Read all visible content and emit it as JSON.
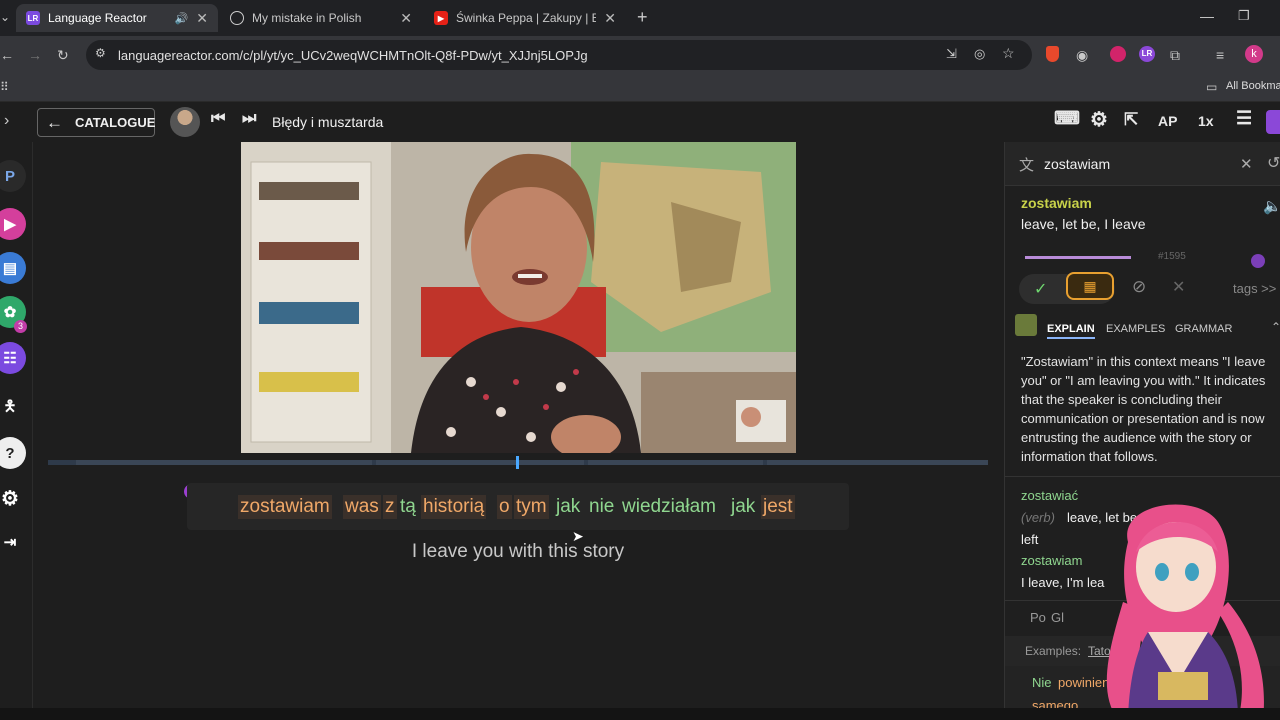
{
  "browser": {
    "tabs": [
      {
        "title": "Language Reactor",
        "active": true
      },
      {
        "title": "My mistake in Polish",
        "active": false
      },
      {
        "title": "Świnka Peppa | Zakupy | Bajki P",
        "active": false
      }
    ],
    "url": "languagereactor.com/c/pl/yt/yc_UCv2weqWCHMTnOlt-Q8f-PDw/yt_XJJnj5LOPJg",
    "bookmarks_label": "All Bookmar"
  },
  "appbar": {
    "catalogue_label": "CATALOGUE",
    "video_title": "Błędy i musztarda",
    "ap_label": "AP",
    "speed_label": "1x"
  },
  "rail": {
    "badge": "3"
  },
  "subtitle": {
    "words": [
      "zostawiam",
      "was",
      "z",
      "tą",
      "historią",
      "o",
      "tym",
      "jak",
      "nie",
      "wiedziałam",
      "jak",
      "jest"
    ],
    "translation": "I leave you with this story"
  },
  "panel": {
    "search_value": "zostawiam",
    "word": "zostawiam",
    "meaning": "leave, let be, I leave",
    "freq": "#1595",
    "tags": "tags >>",
    "tabs": {
      "explain": "EXPLAIN",
      "examples": "EXAMPLES",
      "grammar": "GRAMMAR"
    },
    "explain": "\"Zostawiam\" in this context means \"I leave you\" or \"I am leaving you with.\" It indicates that the speaker is concluding their communication or presentation and is now entrusting the audience with the story or information that follows.",
    "dict": [
      {
        "lemma": "zostawiać",
        "pos": "(verb)",
        "gloss": "leave, let be",
        "gloss2": "left"
      },
      {
        "lemma": "zostawiam",
        "gloss": "I leave, I'm lea"
      }
    ],
    "po_label": "Po",
    "gl_label": "Gl",
    "examples_label": "Examples:",
    "examples_source": "Tatoeb",
    "example_sentence_a": "Nie",
    "example_sentence_b": "powinieneś",
    "example_sentence_c": "osta",
    "example_sentence_d": "samego"
  }
}
